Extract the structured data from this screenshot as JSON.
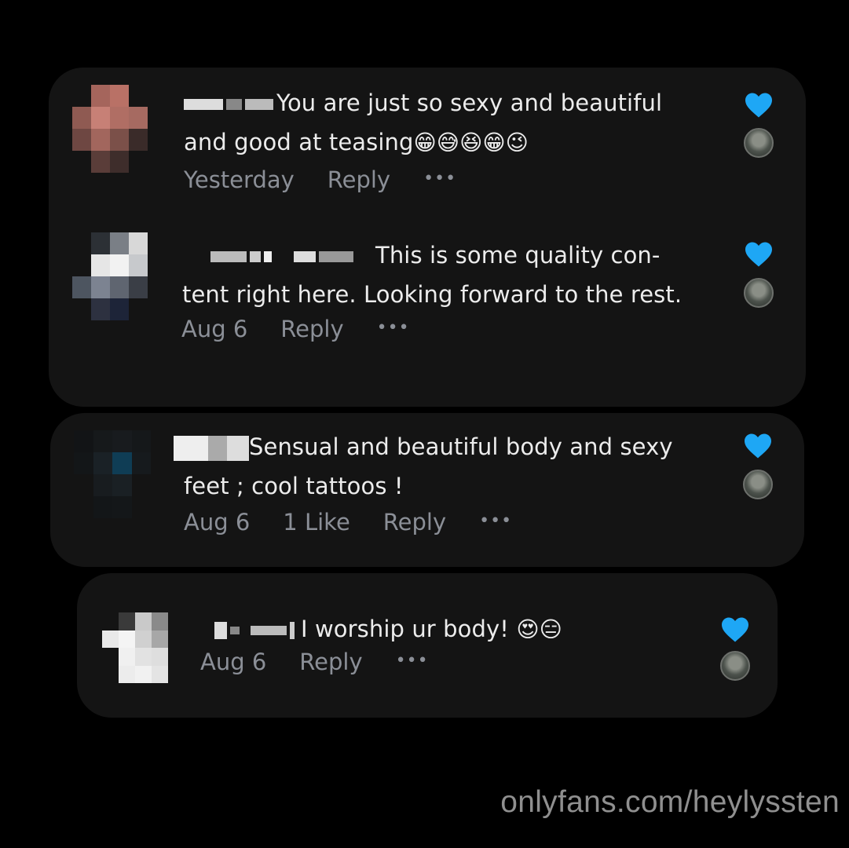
{
  "colors": {
    "background": "#000000",
    "card": "#141414",
    "heart": "#1ea7f5",
    "meta_text": "#8b8f97"
  },
  "comments": [
    {
      "text_line1": "You are just so sexy and beautiful",
      "text_line2": "and good at teasing",
      "emojis": "😁😅😆😁😉",
      "date": "Yesterday",
      "reply": "Reply",
      "more": "•••",
      "liked": true
    },
    {
      "text_line1": "This is some quality con-",
      "text_line2": "tent right here. Looking forward to the rest.",
      "date": "Aug 6",
      "reply": "Reply",
      "more": "•••",
      "liked": true
    },
    {
      "text_line1": "Sensual and beautiful body and sexy",
      "text_line2": "feet ; cool tattoos !",
      "date": "Aug 6",
      "likes": "1 Like",
      "reply": "Reply",
      "more": "•••",
      "liked": true
    },
    {
      "text_line1": "I worship ur body!",
      "emojis": "😍😑",
      "date": "Aug 6",
      "reply": "Reply",
      "more": "•••",
      "liked": true
    }
  ],
  "watermark": "onlyfans.com/heylyssten"
}
